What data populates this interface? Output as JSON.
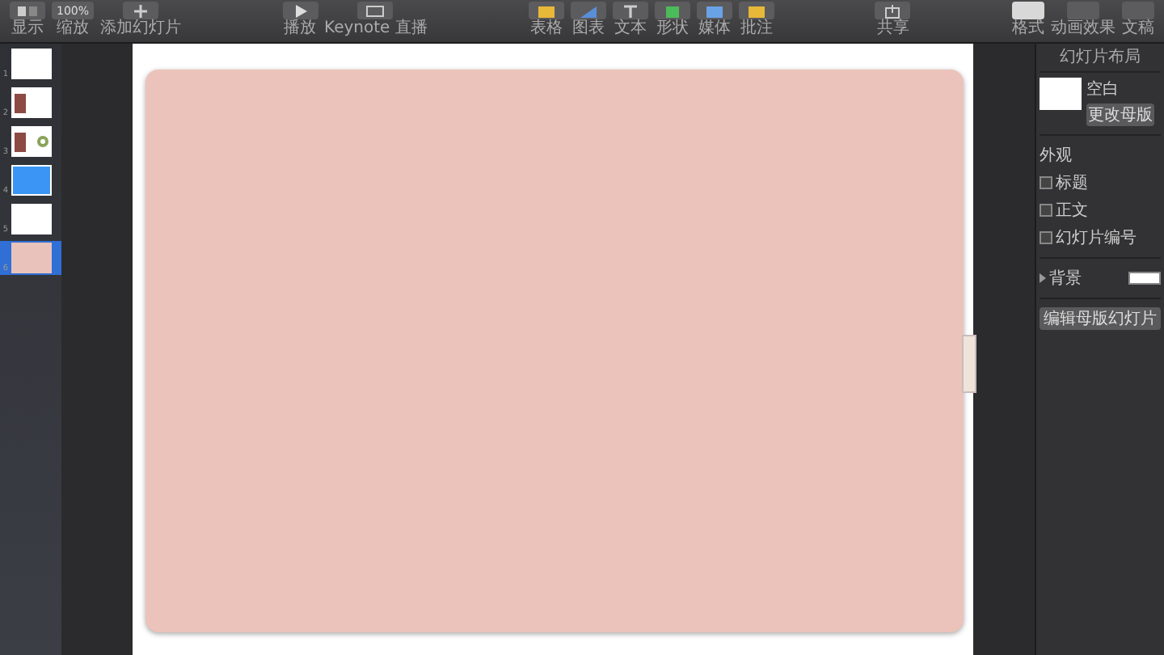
{
  "toolbar": {
    "left": [
      {
        "kind": "view",
        "label": "显示"
      },
      {
        "kind": "zoom",
        "value": "100%",
        "label": "缩放"
      },
      {
        "kind": "add",
        "label": "添加幻灯片"
      }
    ],
    "center_left": [
      {
        "kind": "play",
        "label": "播放"
      },
      {
        "kind": "live",
        "label": "Keynote 直播"
      }
    ],
    "insert": [
      {
        "kind": "table",
        "label": "表格"
      },
      {
        "kind": "chart",
        "label": "图表"
      },
      {
        "kind": "text",
        "label": "文本"
      },
      {
        "kind": "shape",
        "label": "形状"
      },
      {
        "kind": "media",
        "label": "媒体"
      },
      {
        "kind": "comment",
        "label": "批注"
      }
    ],
    "share": {
      "label": "共享"
    },
    "inspector_tabs": [
      {
        "label": "格式",
        "selected": true
      },
      {
        "label": "动画效果",
        "selected": false
      },
      {
        "label": "文稿",
        "selected": false
      }
    ]
  },
  "slides": [
    {
      "number": "1",
      "kind": "blank",
      "selected": false
    },
    {
      "number": "2",
      "kind": "photo",
      "selected": false
    },
    {
      "number": "3",
      "kind": "photo-chart",
      "selected": false
    },
    {
      "number": "4",
      "kind": "blue",
      "selected": false
    },
    {
      "number": "5",
      "kind": "blank",
      "selected": false
    },
    {
      "number": "6",
      "kind": "pink",
      "selected": true
    }
  ],
  "inspector": {
    "title": "幻灯片布局",
    "layout_name": "空白",
    "change_master": "更改母版",
    "appearance": "外观",
    "options": [
      {
        "label": "标题",
        "checked": false
      },
      {
        "label": "正文",
        "checked": false
      },
      {
        "label": "幻灯片编号",
        "checked": false
      }
    ],
    "background": {
      "label": "背景",
      "expanded": false,
      "color": "#ffffff"
    },
    "edit_master": "编辑母版幻灯片"
  }
}
